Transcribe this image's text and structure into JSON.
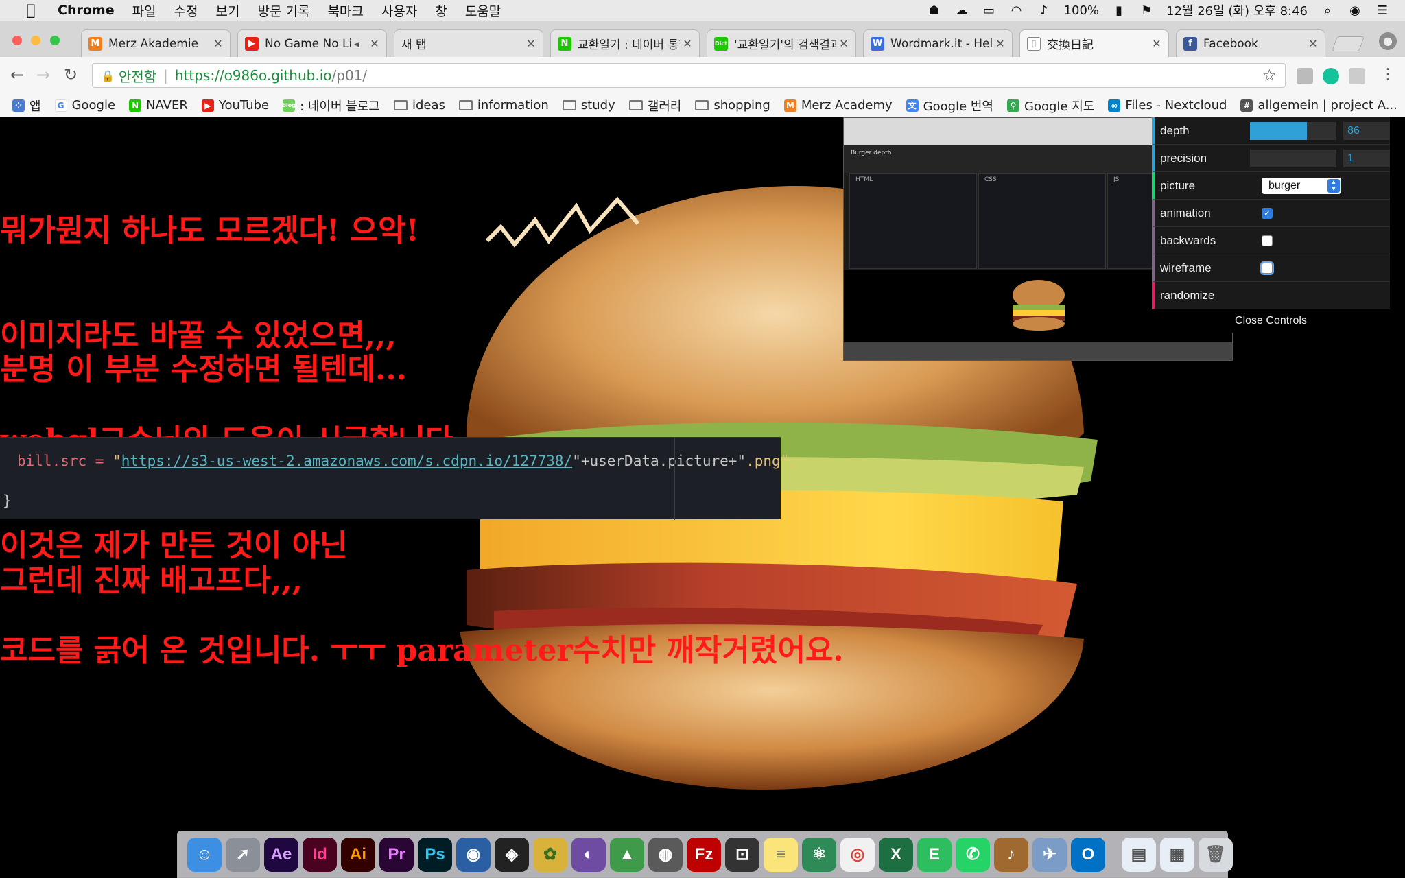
{
  "menubar": {
    "app_name": "Chrome",
    "items": [
      "파일",
      "수정",
      "보기",
      "방문 기록",
      "북마크",
      "사용자",
      "창",
      "도움말"
    ],
    "battery": "100%",
    "datetime": "12월 26일 (화) 오후 8:46"
  },
  "tabs": [
    {
      "label": "Merz Akademie",
      "favicon": "M",
      "color": "#f07f1f"
    },
    {
      "label": "No Game No Li",
      "favicon": "▶",
      "color": "#e62117"
    },
    {
      "label": "새 탭",
      "favicon": "",
      "color": "transparent"
    },
    {
      "label": "교환일기 : 네이버 통합",
      "favicon": "N",
      "color": "#1ec800"
    },
    {
      "label": "'교환일기'의 검색결과",
      "favicon": "Dict",
      "color": "#1ec800"
    },
    {
      "label": "Wordmark.it - Help",
      "favicon": "W",
      "color": "#3b6ddf"
    },
    {
      "label": "交換日記",
      "favicon": "",
      "color": "transparent"
    },
    {
      "label": "Facebook",
      "favicon": "f",
      "color": "#3b5998"
    }
  ],
  "addressbar": {
    "secure_label": "안전함",
    "url_host": "https://o986o.github.io",
    "url_path": "/p01/"
  },
  "bookmarks": [
    {
      "label": "앱",
      "icon": "apps-icon"
    },
    {
      "label": "Google",
      "icon": "google-icon"
    },
    {
      "label": "NAVER",
      "icon": "naver-icon"
    },
    {
      "label": "YouTube",
      "icon": "youtube-icon"
    },
    {
      "label": ": 네이버 블로그",
      "icon": "blog-icon"
    },
    {
      "label": "ideas",
      "icon": "folder-icon"
    },
    {
      "label": "information",
      "icon": "folder-icon"
    },
    {
      "label": "study",
      "icon": "folder-icon"
    },
    {
      "label": "갤러리",
      "icon": "folder-icon"
    },
    {
      "label": "shopping",
      "icon": "folder-icon"
    },
    {
      "label": "Merz Academy",
      "icon": "merz-icon"
    },
    {
      "label": "Google 번역",
      "icon": "translate-icon"
    },
    {
      "label": "Google 지도",
      "icon": "maps-icon"
    },
    {
      "label": "Files - Nextcloud",
      "icon": "nextcloud-icon"
    },
    {
      "label": "allgemein | project A...",
      "icon": "hash-icon"
    }
  ],
  "page": {
    "text_lines_1": [
      "뭐가뭔지 하나도 모르겠다! 으악!",
      "이미지라도 바꿀 수 있었으면,,,",
      "webgl고수님의 도움이 시급합니다.",
      "이것은 제가 만든 것이 아닌",
      "코드를 긁어 온 것입니다. ㅜㅜ parameter수치만 깨작거렸어요."
    ],
    "text_line_2": "분명 이 부분 수정하면 될텐데...",
    "text_line_3": "그런데 진짜 배고프다,,,",
    "code": {
      "prefix": "bill.src = ",
      "quote_open": "\"",
      "link": "https://s3-us-west-2.amazonaws.com/s.cdpn.io/127738/",
      "middle": "\"+userData.picture+\"",
      "suffix": ".png\";",
      "closing": "}"
    }
  },
  "gui": {
    "depth": {
      "label": "depth",
      "value": "86",
      "fill_fraction": 0.66
    },
    "precision": {
      "label": "precision",
      "value": "1"
    },
    "picture": {
      "label": "picture",
      "value": "burger"
    },
    "animation": {
      "label": "animation",
      "checked": true
    },
    "backwards": {
      "label": "backwards",
      "checked": false
    },
    "wireframe": {
      "label": "wireframe",
      "checked": false
    },
    "randomize": {
      "label": "randomize"
    },
    "close_label": "Close Controls"
  },
  "thumbnail": {
    "title": "Burger depth",
    "panes": [
      "HTML",
      "CSS",
      "JS"
    ]
  },
  "dock": [
    {
      "name": "finder-icon",
      "glyph": "☺",
      "bg": "#3d8fe3",
      "fg": "#fff"
    },
    {
      "name": "launchpad-icon",
      "glyph": "➚",
      "bg": "#8a8f98",
      "fg": "#fff"
    },
    {
      "name": "after-effects-icon",
      "glyph": "Ae",
      "bg": "#1f0740",
      "fg": "#d8a1ff"
    },
    {
      "name": "indesign-icon",
      "glyph": "Id",
      "bg": "#49021f",
      "fg": "#ff3f94"
    },
    {
      "name": "illustrator-icon",
      "glyph": "Ai",
      "bg": "#330000",
      "fg": "#ff9a00"
    },
    {
      "name": "premiere-icon",
      "glyph": "Pr",
      "bg": "#2a0634",
      "fg": "#ea77ff"
    },
    {
      "name": "photoshop-icon",
      "glyph": "Ps",
      "bg": "#001d26",
      "fg": "#31c5f0"
    },
    {
      "name": "cinema4d-icon",
      "glyph": "◉",
      "bg": "#2b5fa3",
      "fg": "#fff"
    },
    {
      "name": "unity-icon",
      "glyph": "◈",
      "bg": "#222",
      "fg": "#fff"
    },
    {
      "name": "pineapple-icon",
      "glyph": "✿",
      "bg": "#d8b23a",
      "fg": "#3d6b1c"
    },
    {
      "name": "github-icon",
      "glyph": "◐",
      "bg": "#6e4ca1",
      "fg": "#fff"
    },
    {
      "name": "android-studio-icon",
      "glyph": "▲",
      "bg": "#3f9a4a",
      "fg": "#fff"
    },
    {
      "name": "sequel-icon",
      "glyph": "◍",
      "bg": "#5a5a5a",
      "fg": "#fff"
    },
    {
      "name": "filezilla-icon",
      "glyph": "Fz",
      "bg": "#bf0000",
      "fg": "#fff"
    },
    {
      "name": "processing-icon",
      "glyph": "⊡",
      "bg": "#333",
      "fg": "#fff"
    },
    {
      "name": "notes-icon",
      "glyph": "≡",
      "bg": "#fbe57a",
      "fg": "#777"
    },
    {
      "name": "atom-icon",
      "glyph": "⚛",
      "bg": "#2e8b57",
      "fg": "#fff"
    },
    {
      "name": "chrome-icon",
      "glyph": "◎",
      "bg": "#f1f1f1",
      "fg": "#db4437"
    },
    {
      "name": "excel-icon",
      "glyph": "X",
      "bg": "#1d6f42",
      "fg": "#fff"
    },
    {
      "name": "evernote-icon",
      "glyph": "E",
      "bg": "#2dbe60",
      "fg": "#fff"
    },
    {
      "name": "whatsapp-icon",
      "glyph": "✆",
      "bg": "#25d366",
      "fg": "#fff"
    },
    {
      "name": "guitar-icon",
      "glyph": "♪",
      "bg": "#a0692f",
      "fg": "#fff"
    },
    {
      "name": "preview-icon",
      "glyph": "✈",
      "bg": "#7a9cc6",
      "fg": "#fff"
    },
    {
      "name": "outlook-icon",
      "glyph": "O",
      "bg": "#0072c6",
      "fg": "#fff"
    },
    {
      "name": "folder-docs-icon",
      "glyph": "▤",
      "bg": "#e8eef5",
      "fg": "#555"
    },
    {
      "name": "folder-downloads-icon",
      "glyph": "▦",
      "bg": "#e8eef5",
      "fg": "#555"
    },
    {
      "name": "trash-icon",
      "glyph": "🗑",
      "bg": "#d7dbe0",
      "fg": "#666"
    }
  ]
}
